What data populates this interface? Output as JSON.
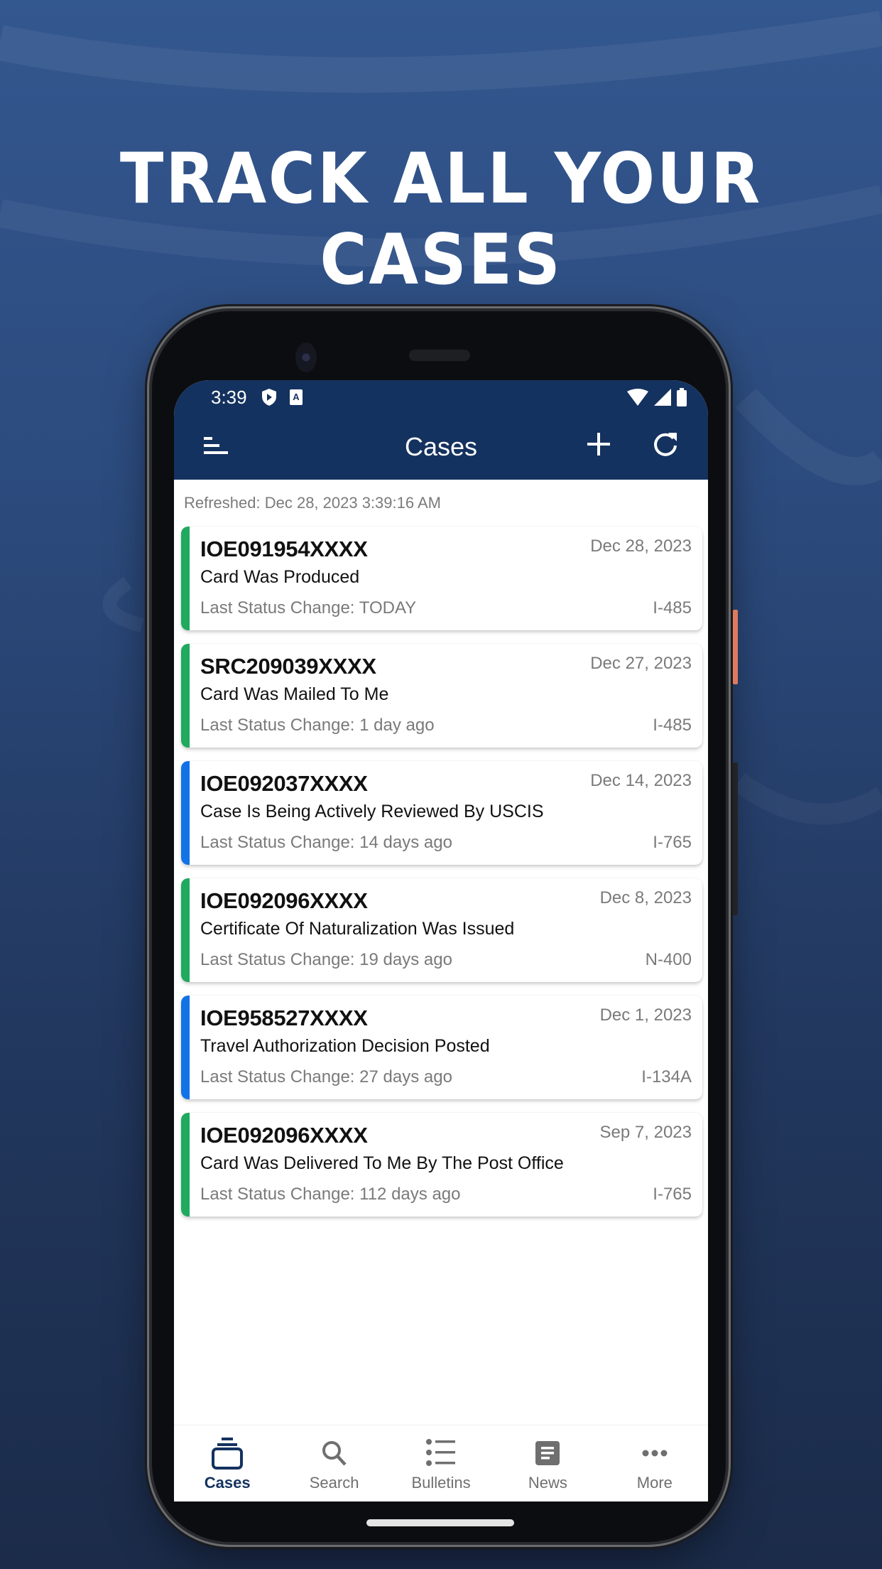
{
  "headline": "TRACK ALL YOUR CASES",
  "colors": {
    "brand_navy": "#14325f",
    "status_green": "#1faa5f",
    "status_blue": "#1273e6",
    "side_button": "#e07a5f"
  },
  "status_bar": {
    "time": "3:39",
    "left_icons": [
      "shield-play-icon",
      "keyboard-a-icon"
    ],
    "right_icons": [
      "wifi-icon",
      "signal-icon",
      "battery-icon"
    ]
  },
  "toolbar": {
    "title": "Cases",
    "menu_icon": "menu-icon",
    "add_icon": "plus-icon",
    "refresh_icon": "refresh-icon"
  },
  "refreshed": "Refreshed: Dec 28, 2023 3:39:16 AM",
  "cases": [
    {
      "id": "IOE091954XXXX",
      "date": "Dec 28, 2023",
      "status": "Card Was Produced",
      "last_change": "Last Status Change: TODAY",
      "form": "I-485",
      "color": "green"
    },
    {
      "id": "SRC209039XXXX",
      "date": "Dec 27, 2023",
      "status": "Card Was Mailed To Me",
      "last_change": "Last Status Change: 1 day ago",
      "form": "I-485",
      "color": "green"
    },
    {
      "id": "IOE092037XXXX",
      "date": "Dec 14, 2023",
      "status": "Case Is Being Actively Reviewed By USCIS",
      "last_change": "Last Status Change: 14 days ago",
      "form": "I-765",
      "color": "blue"
    },
    {
      "id": "IOE092096XXXX",
      "date": "Dec 8, 2023",
      "status": "Certificate Of Naturalization Was Issued",
      "last_change": "Last Status Change: 19 days ago",
      "form": "N-400",
      "color": "green"
    },
    {
      "id": "IOE958527XXXX",
      "date": "Dec 1, 2023",
      "status": "Travel Authorization Decision Posted",
      "last_change": "Last Status Change: 27 days ago",
      "form": "I-134A",
      "color": "blue"
    },
    {
      "id": "IOE092096XXXX",
      "date": "Sep 7, 2023",
      "status": "Card Was Delivered To Me By The Post Office",
      "last_change": "Last Status Change: 112 days ago",
      "form": "I-765",
      "color": "green"
    }
  ],
  "tabs": [
    {
      "label": "Cases",
      "icon": "cases-stack-icon",
      "active": true
    },
    {
      "label": "Search",
      "icon": "search-icon",
      "active": false
    },
    {
      "label": "Bulletins",
      "icon": "bulleted-list-icon",
      "active": false
    },
    {
      "label": "News",
      "icon": "news-article-icon",
      "active": false
    },
    {
      "label": "More",
      "icon": "more-dots-icon",
      "active": false
    }
  ]
}
